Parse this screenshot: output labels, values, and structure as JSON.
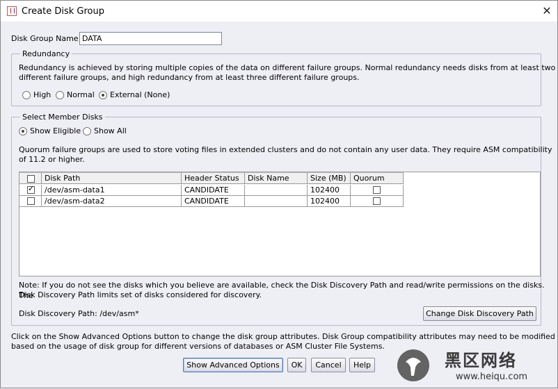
{
  "window": {
    "title": "Create Disk Group",
    "close_icon": "close-icon"
  },
  "disk_group_name": {
    "label": "Disk Group Name",
    "value": "DATA"
  },
  "redundancy": {
    "title": "Redundancy",
    "description_line1": "Redundancy is achieved by storing multiple copies of the data on different failure groups. Normal redundancy needs disks from at least two",
    "description_line2": "different failure groups, and high redundancy from at least three different failure groups.",
    "options": [
      {
        "label": "High",
        "selected": false
      },
      {
        "label": "Normal",
        "selected": false
      },
      {
        "label": "External (None)",
        "selected": true
      }
    ]
  },
  "member_disks": {
    "title": "Select Member Disks",
    "filter_options": [
      {
        "label": "Show Eligible",
        "selected": true
      },
      {
        "label": "Show All",
        "selected": false
      }
    ],
    "quorum_note_line1": "Quorum failure groups are used to store voting files in extended clusters and do not contain any user data. They require ASM compatibility",
    "quorum_note_line2": "of 11.2 or higher.",
    "table": {
      "columns": [
        "",
        "Disk Path",
        "Header Status",
        "Disk Name",
        "Size (MB)",
        "Quorum"
      ],
      "rows": [
        {
          "selected": true,
          "disk_path": "/dev/asm-data1",
          "header_status": "CANDIDATE",
          "disk_name": "",
          "size_mb": "102400",
          "quorum": false
        },
        {
          "selected": false,
          "disk_path": "/dev/asm-data2",
          "header_status": "CANDIDATE",
          "disk_name": "",
          "size_mb": "102400",
          "quorum": false
        }
      ]
    },
    "note_line1": "Note: If you do not see the disks which you believe are available, check the Disk Discovery Path and read/write permissions on the disks. The",
    "note_line2": "Disk Discovery Path limits set of disks considered for discovery.",
    "discovery_path": "Disk Discovery Path: /dev/asm*",
    "change_path_button": "Change Disk Discovery Path"
  },
  "advanced_note_line1": "Click on the Show Advanced Options button to change the disk group attributes. Disk Group compatibility attributes may need to be modified",
  "advanced_note_line2": "based on the usage of disk group for different versions of databases or ASM Cluster File Systems.",
  "buttons": {
    "advanced": "Show Advanced Options",
    "ok": "OK",
    "cancel": "Cancel",
    "help": "Help"
  },
  "watermark": {
    "text_cn": "黑区网络",
    "url": "www.heiqu.com"
  }
}
